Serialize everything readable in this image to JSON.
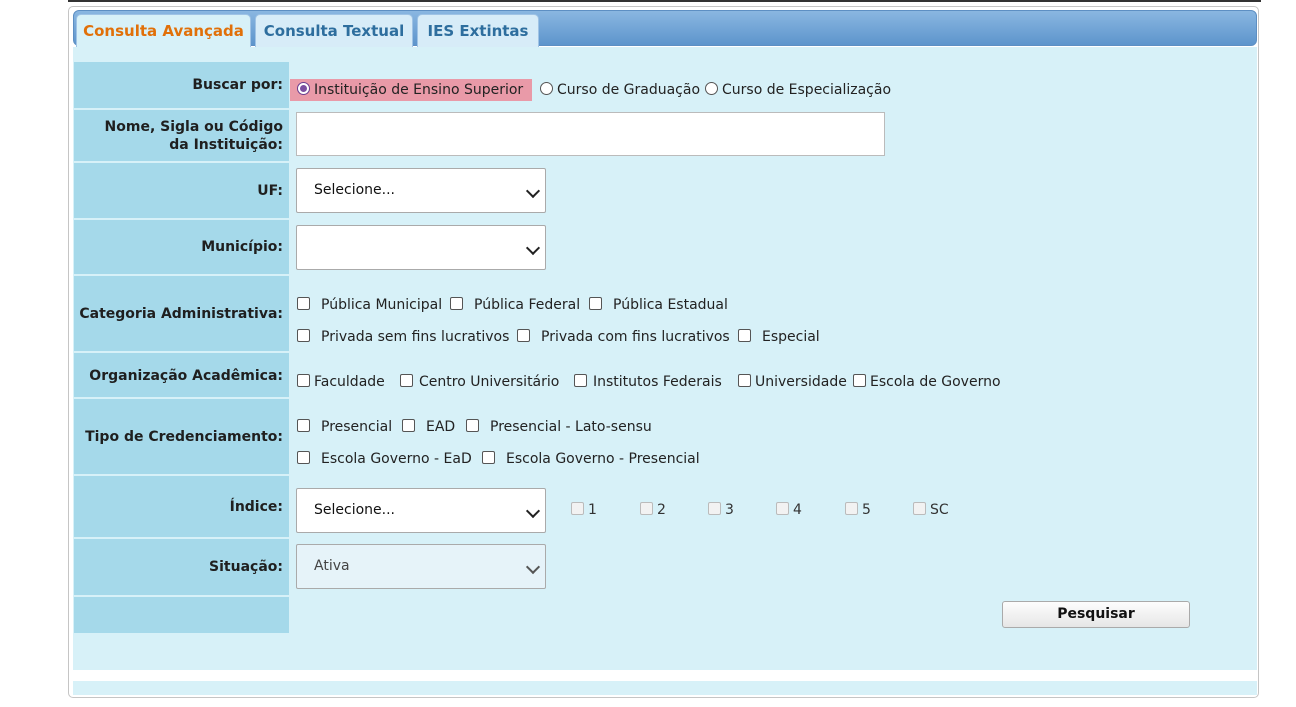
{
  "tabs": [
    {
      "label": "Consulta Avançada",
      "active": true
    },
    {
      "label": "Consulta Textual",
      "active": false
    },
    {
      "label": "IES Extintas",
      "active": false
    }
  ],
  "buscar_por": {
    "label": "Buscar por:",
    "options": [
      "Instituição de Ensino Superior",
      "Curso de Graduação",
      "Curso de Especialização"
    ],
    "selected": "Instituição de Ensino Superior"
  },
  "nome": {
    "label": "Nome, Sigla ou Código da Instituição:",
    "value": ""
  },
  "uf": {
    "label": "UF:",
    "value": "Selecione..."
  },
  "municipio": {
    "label": "Município:",
    "value": ""
  },
  "categoria": {
    "label": "Categoria Administrativa:",
    "options": [
      "Pública Municipal",
      "Pública Federal",
      "Pública Estadual",
      "Privada sem fins lucrativos",
      "Privada com fins lucrativos",
      "Especial"
    ]
  },
  "organizacao": {
    "label": "Organização Acadêmica:",
    "options": [
      "Faculdade",
      "Centro Universitário",
      "Institutos Federais",
      "Universidade",
      "Escola de Governo"
    ]
  },
  "credenciamento": {
    "label": "Tipo de Credenciamento:",
    "options": [
      "Presencial",
      "EAD",
      "Presencial - Lato-sensu",
      "Escola Governo - EaD",
      "Escola Governo - Presencial"
    ]
  },
  "indice": {
    "label": "Índice:",
    "value": "Selecione...",
    "options": [
      "1",
      "2",
      "3",
      "4",
      "5",
      "SC"
    ]
  },
  "situacao": {
    "label": "Situação:",
    "value": "Ativa"
  },
  "search_button": "Pesquisar",
  "colors": {
    "active_tab": "#e17009",
    "tab_text": "#2e6e9e",
    "label_bg": "#a5d9ea",
    "content_bg": "#d7f1f8",
    "highlight": "#e99aa8"
  }
}
